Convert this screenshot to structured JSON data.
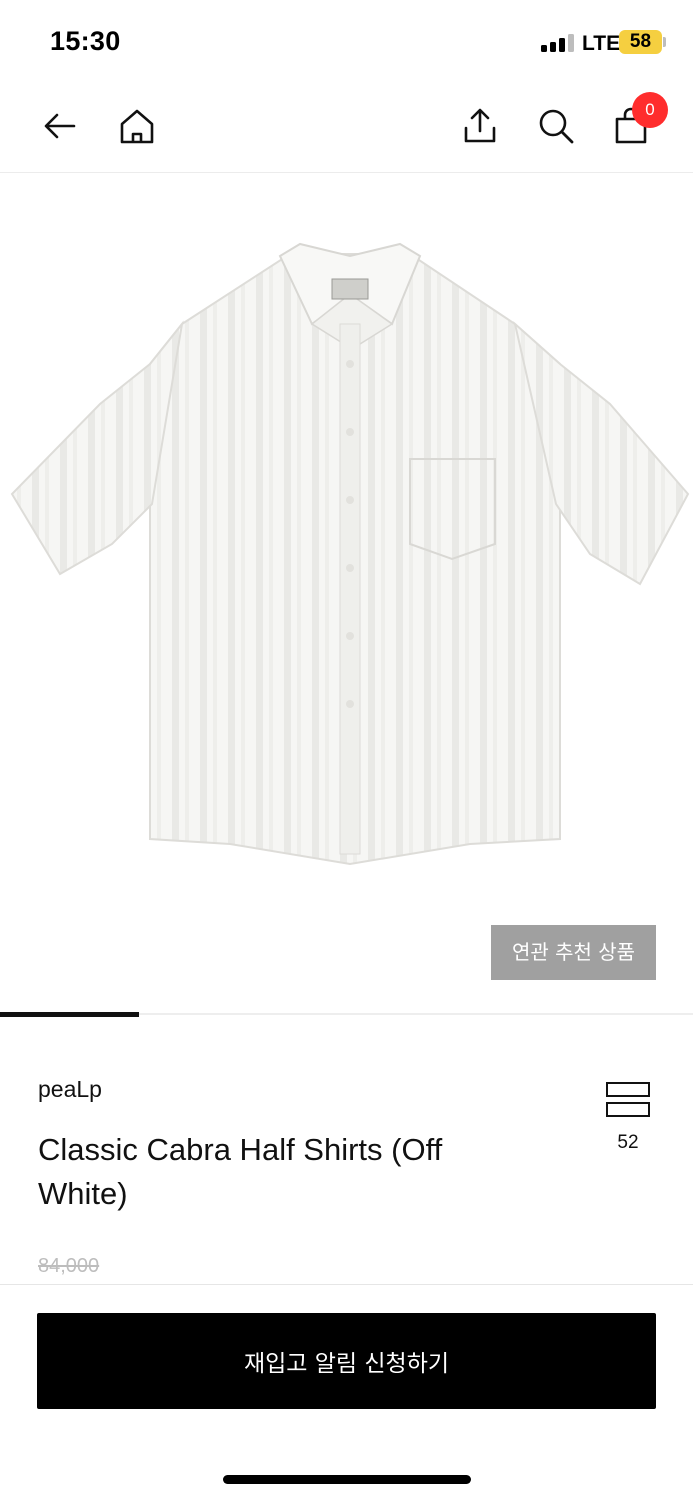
{
  "status_bar": {
    "time": "15:30",
    "network": "LTE",
    "battery_level": "58",
    "icons": [
      "signal-icon",
      "battery-icon"
    ]
  },
  "nav": {
    "icons": [
      "back-arrow-icon",
      "home-icon",
      "share-icon",
      "search-icon",
      "shopping-bag-icon"
    ],
    "cart_count": "0"
  },
  "product": {
    "image_description_icon": "shirt-image",
    "related_button_label": "연관 추천 상품",
    "image_progress_fraction": 0.2,
    "brand": "peaLp",
    "title": "Classic Cabra Half Shirts (Off White)",
    "view_count": "52",
    "original_price": "84,000"
  },
  "cta": {
    "restock_button_label": "재입고 알림 신청하기"
  },
  "colors": {
    "accent": "#000000",
    "badge": "#ff2d2d",
    "related_button": "#a0a0a0",
    "battery": "#f5cf40",
    "strikethrough_price": "#bdbdbd"
  }
}
